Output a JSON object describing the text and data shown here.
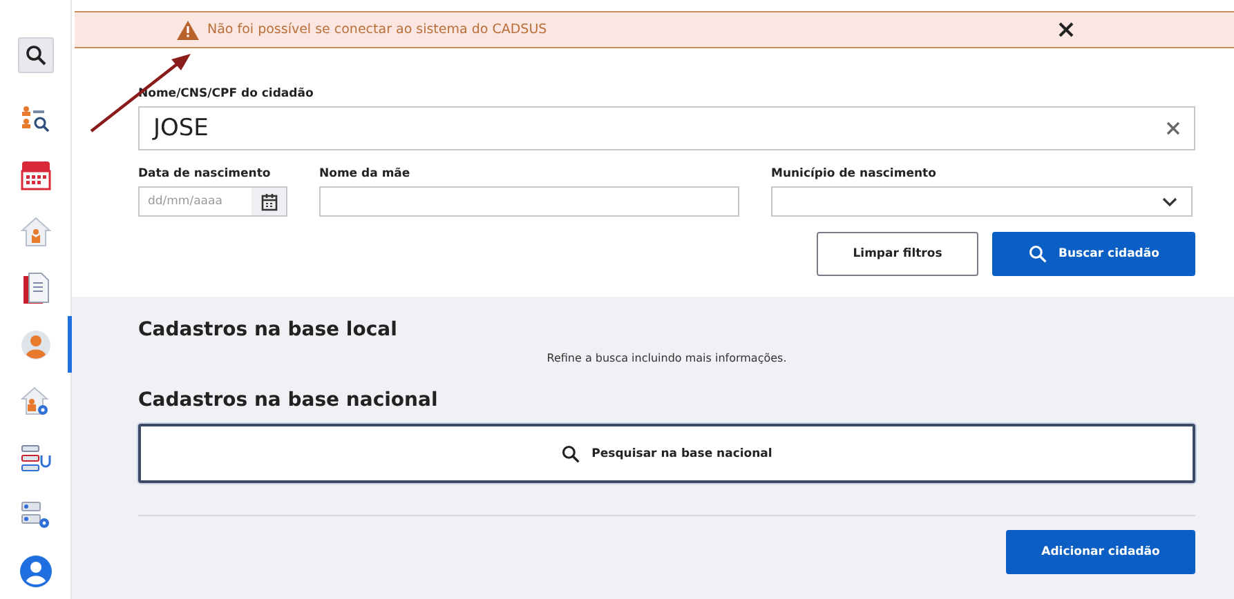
{
  "sidebar": {
    "items": [
      {
        "kind": "search",
        "selected": false
      },
      {
        "kind": "people-search",
        "selected": false
      },
      {
        "kind": "calendar",
        "selected": false
      },
      {
        "kind": "house-person",
        "selected": false
      },
      {
        "kind": "document",
        "selected": false
      },
      {
        "kind": "person",
        "selected": true
      },
      {
        "kind": "house-gear",
        "selected": false
      },
      {
        "kind": "list-stethoscope",
        "selected": false
      },
      {
        "kind": "list-gear",
        "selected": false
      },
      {
        "kind": "person-circle",
        "selected": false
      }
    ]
  },
  "alert": {
    "message": "Não foi possível se conectar ao sistema do CADSUS"
  },
  "search_form": {
    "name_field": {
      "label": "Nome/CNS/CPF do cidadão",
      "value": "JOSE"
    },
    "birth_date": {
      "label": "Data de nascimento",
      "placeholder": "dd/mm/aaaa"
    },
    "mother_name": {
      "label": "Nome da mãe"
    },
    "birth_city": {
      "label": "Município de nascimento"
    },
    "buttons": [
      {
        "label": "Limpar filtros",
        "kind": "secondary"
      },
      {
        "label": "Buscar cidadão",
        "kind": "primary"
      }
    ]
  },
  "local_results": {
    "title": "Cadastros na base local",
    "hint": "Refine a busca incluindo mais informações."
  },
  "national_results": {
    "title": "Cadastros na base nacional",
    "search_button": "Pesquisar na base nacional"
  },
  "add_button": "Adicionar cidadão"
}
